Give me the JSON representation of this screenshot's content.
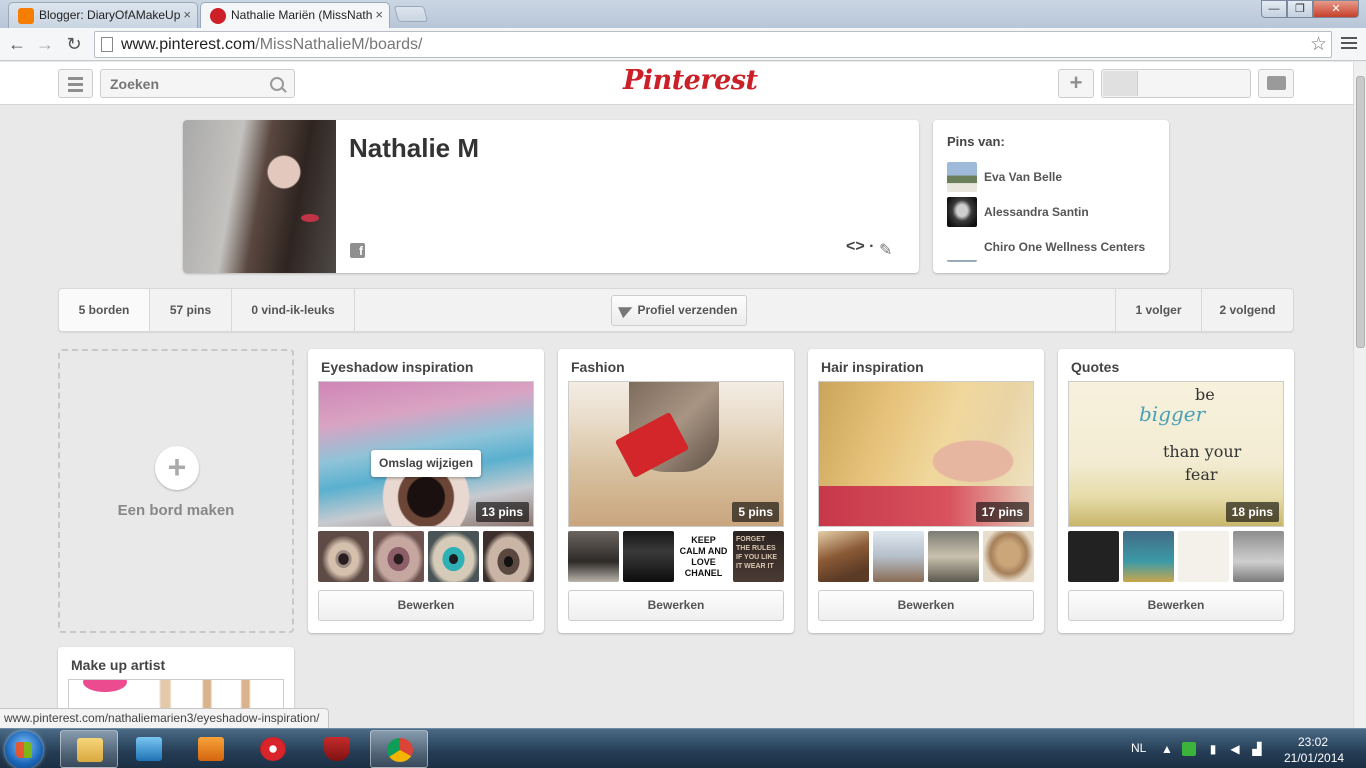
{
  "browser": {
    "tabs": [
      {
        "label": "Blogger: DiaryOfAMakeUp",
        "close": "×"
      },
      {
        "label": "Nathalie Mariën (MissNath",
        "close": "×"
      }
    ],
    "window_controls": {
      "minimize": "—",
      "maximize": "❐",
      "close": "✕"
    },
    "nav": {
      "back": "←",
      "forward": "→",
      "reload": "↻"
    },
    "url_host": "www.pinterest.com",
    "url_path": "/MissNathalieM/boards/",
    "status_url": "www.pinterest.com/nathaliemarien3/eyeshadow-inspiration/"
  },
  "header": {
    "search_placeholder": "Zoeken",
    "logo": "Pinterest",
    "add_label": "+"
  },
  "profile": {
    "name": "Nathalie M",
    "facebook_glyph": "f",
    "embed_glyph": "<> ·",
    "edit_glyph": "✎"
  },
  "pins_from": {
    "title": "Pins van:",
    "items": [
      {
        "name": "Eva Van Belle",
        "color": "#6d8fb8"
      },
      {
        "name": "Alessandra Santin",
        "color": "#3b3b3b"
      },
      {
        "name": "Chiro One Wellness Centers",
        "color": "#ffffff"
      }
    ]
  },
  "stats": {
    "boards": "5 borden",
    "pins": "57 pins",
    "likes": "0 vind-ik-leuks",
    "send_profile": "Profiel verzenden",
    "followers": "1 volger",
    "following": "2 volgend"
  },
  "create_board": {
    "label": "Een bord maken",
    "plus": "+"
  },
  "boards": [
    {
      "title": "Eyeshadow inspiration",
      "count": "13 pins",
      "edit": "Bewerken",
      "change_cover": "Omslag wijzigen"
    },
    {
      "title": "Fashion",
      "count": "5 pins",
      "edit": "Bewerken",
      "thumb3": "KEEP CALM AND LOVE CHANEL",
      "thumb4": "FORGET THE RULES IF YOU LIKE IT WEAR IT"
    },
    {
      "title": "Hair inspiration",
      "count": "17 pins",
      "edit": "Bewerken"
    },
    {
      "title": "Quotes",
      "count": "18 pins",
      "edit": "Bewerken",
      "quote_lines": [
        "be",
        "bigger",
        "than your",
        "fear"
      ]
    },
    {
      "title": "Make up artist"
    }
  ],
  "taskbar": {
    "language": "NL",
    "time": "23:02",
    "date": "21/01/2014"
  }
}
